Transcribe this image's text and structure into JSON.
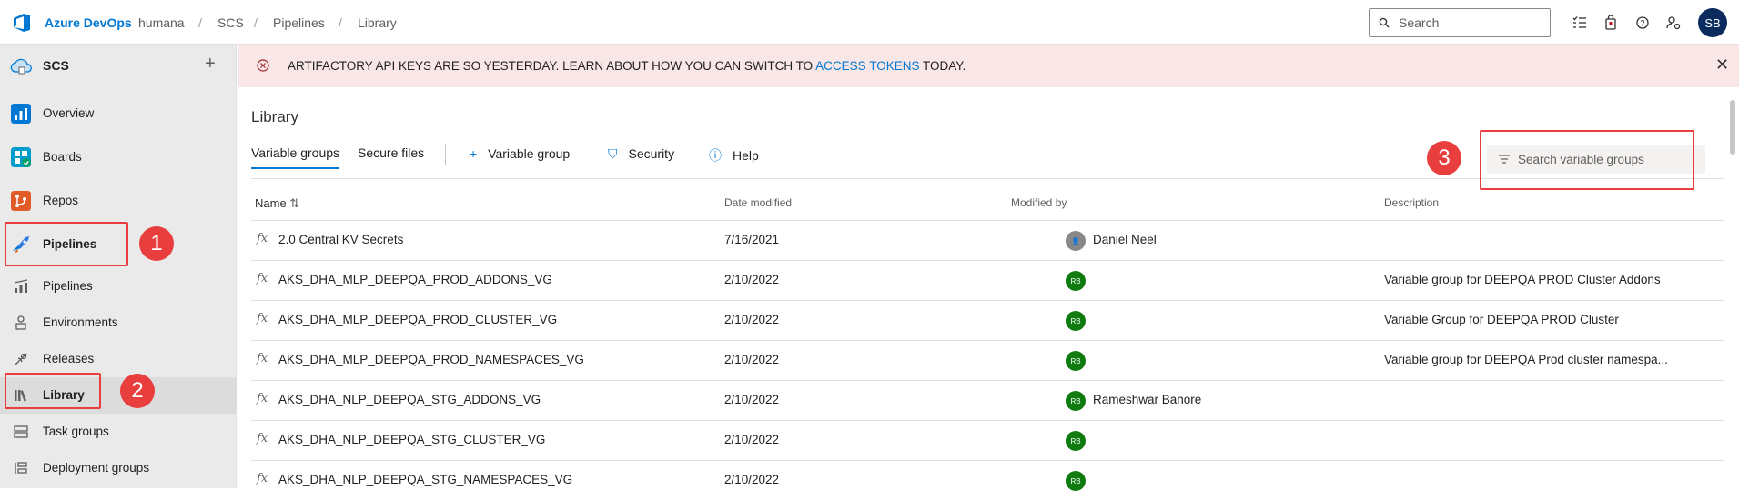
{
  "topbar": {
    "brand": "Azure DevOps",
    "org": "humana",
    "project": "SCS",
    "section": "Pipelines",
    "page": "Library",
    "search_placeholder": "Search",
    "user_initials": "SB"
  },
  "sidebar": {
    "project_name": "SCS",
    "items": [
      {
        "label": "Overview"
      },
      {
        "label": "Boards"
      },
      {
        "label": "Repos"
      },
      {
        "label": "Pipelines"
      }
    ],
    "sub_items": [
      {
        "label": "Pipelines"
      },
      {
        "label": "Environments"
      },
      {
        "label": "Releases"
      },
      {
        "label": "Library"
      },
      {
        "label": "Task groups"
      },
      {
        "label": "Deployment groups"
      }
    ]
  },
  "banner": {
    "text_before": "ARTIFACTORY API KEYS ARE SO YESTERDAY. LEARN ABOUT HOW YOU CAN SWITCH TO ",
    "link": "ACCESS TOKENS",
    "text_after": " TODAY."
  },
  "main": {
    "title": "Library",
    "tabs": [
      "Variable groups",
      "Secure files"
    ],
    "actions": [
      "Variable group",
      "Security",
      "Help"
    ],
    "search_placeholder": "Search variable groups",
    "columns": [
      "Name",
      "Date modified",
      "Modified by",
      "Description"
    ],
    "rows": [
      {
        "name": "2.0 Central KV Secrets",
        "date": "7/16/2021",
        "by_initials": "",
        "by": "Daniel Neel",
        "desc": ""
      },
      {
        "name": "AKS_DHA_MLP_DEEPQA_PROD_ADDONS_VG",
        "date": "2/10/2022",
        "by_initials": "RB",
        "by": "",
        "desc": "Variable group for DEEPQA PROD Cluster Addons"
      },
      {
        "name": "AKS_DHA_MLP_DEEPQA_PROD_CLUSTER_VG",
        "date": "2/10/2022",
        "by_initials": "RB",
        "by": "",
        "desc": "Variable Group for DEEPQA PROD Cluster"
      },
      {
        "name": "AKS_DHA_MLP_DEEPQA_PROD_NAMESPACES_VG",
        "date": "2/10/2022",
        "by_initials": "RB",
        "by": "",
        "desc": "Variable group for DEEPQA Prod cluster namespa..."
      },
      {
        "name": "AKS_DHA_NLP_DEEPQA_STG_ADDONS_VG",
        "date": "2/10/2022",
        "by_initials": "RB",
        "by": "Rameshwar Banore",
        "desc": ""
      },
      {
        "name": "AKS_DHA_NLP_DEEPQA_STG_CLUSTER_VG",
        "date": "2/10/2022",
        "by_initials": "RB",
        "by": "",
        "desc": ""
      },
      {
        "name": "AKS_DHA_NLP_DEEPQA_STG_NAMESPACES_VG",
        "date": "2/10/2022",
        "by_initials": "RB",
        "by": "",
        "desc": ""
      }
    ]
  },
  "callouts": [
    "1",
    "2",
    "3"
  ],
  "colors": {
    "accent": "#0078d4",
    "callout": "#e83e3e",
    "banner_bg": "#f9e6e6",
    "badge": "#107c10"
  }
}
